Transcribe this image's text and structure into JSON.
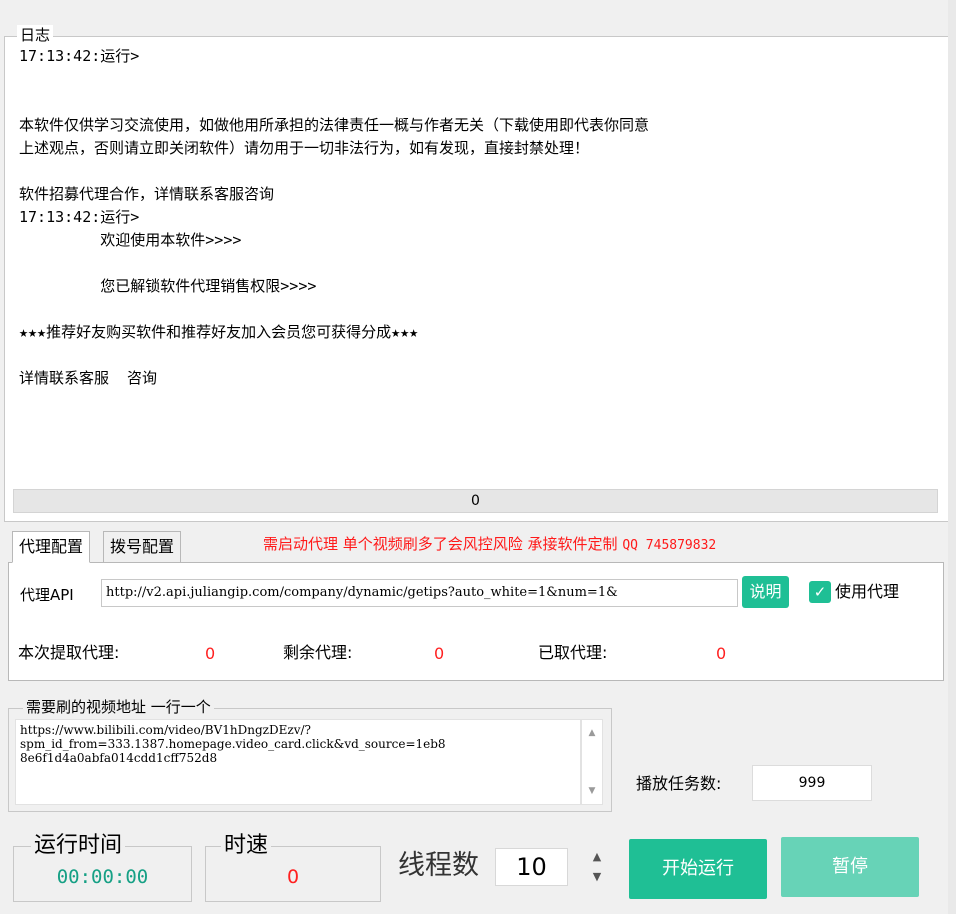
{
  "log": {
    "legend": "日志",
    "text": "17:13:42:运行>\n\n\n本软件仅供学习交流使用，如做他用所承担的法律责任一概与作者无关（下载使用即代表你同意\n上述观点，否则请立即关闭软件）请勿用于一切非法行为，如有发现，直接封禁处理！\n\n软件招募代理合作，详情联系客服咨询\n17:13:42:运行>\n         欢迎使用本软件>>>>\n\n         您已解锁软件代理销售权限>>>>\n\n★★★推荐好友购买软件和推荐好友加入会员您可获得分成★★★\n\n详情联系客服  咨询",
    "progress_value": "0"
  },
  "tabs": [
    {
      "label": "代理配置",
      "active": true
    },
    {
      "label": "拨号配置",
      "active": false
    }
  ],
  "warning": {
    "text": "需启动代理 单个视频刷多了会风控风险  承接软件定制 ",
    "qq": "QQ 745879832"
  },
  "proxy": {
    "api_label": "代理API",
    "api_value": "http://v2.api.juliangip.com/company/dynamic/getips?auto_white=1&num=1&",
    "help_label": "说明",
    "use_proxy_label": "使用代理",
    "use_proxy_checked": true,
    "fetched_label": "本次提取代理:",
    "fetched_value": "0",
    "remaining_label": "剩余代理:",
    "remaining_value": "0",
    "taken_label": "已取代理:",
    "taken_value": "0"
  },
  "videos": {
    "legend": "需要刷的视频地址  一行一个",
    "urls_text": "https://www.bilibili.com/video/BV1hDngzDEzv/?\nspm_id_from=333.1387.homepage.video_card.click&vd_source=1eb8\n8e6f1d4a0abfa014cdd1cff752d8"
  },
  "task": {
    "label": "播放任务数:",
    "value": "999"
  },
  "runtime": {
    "legend": "运行时间",
    "value": "00:00:00"
  },
  "speed": {
    "legend": "时速",
    "value": "0"
  },
  "threads": {
    "label": "线程数",
    "value": "10"
  },
  "buttons": {
    "start_label": "开始运行",
    "pause_label": "暂停"
  },
  "colors": {
    "accent": "#1fbf95",
    "accent_light": "#67d3b7",
    "warning": "#ff1a1a",
    "time_text": "#16a085"
  },
  "icons": {
    "checkbox": "check-icon",
    "scroll_up": "chevron-up-icon",
    "scroll_down": "chevron-down-icon",
    "spin_up": "triangle-up-icon",
    "spin_down": "triangle-down-icon"
  }
}
